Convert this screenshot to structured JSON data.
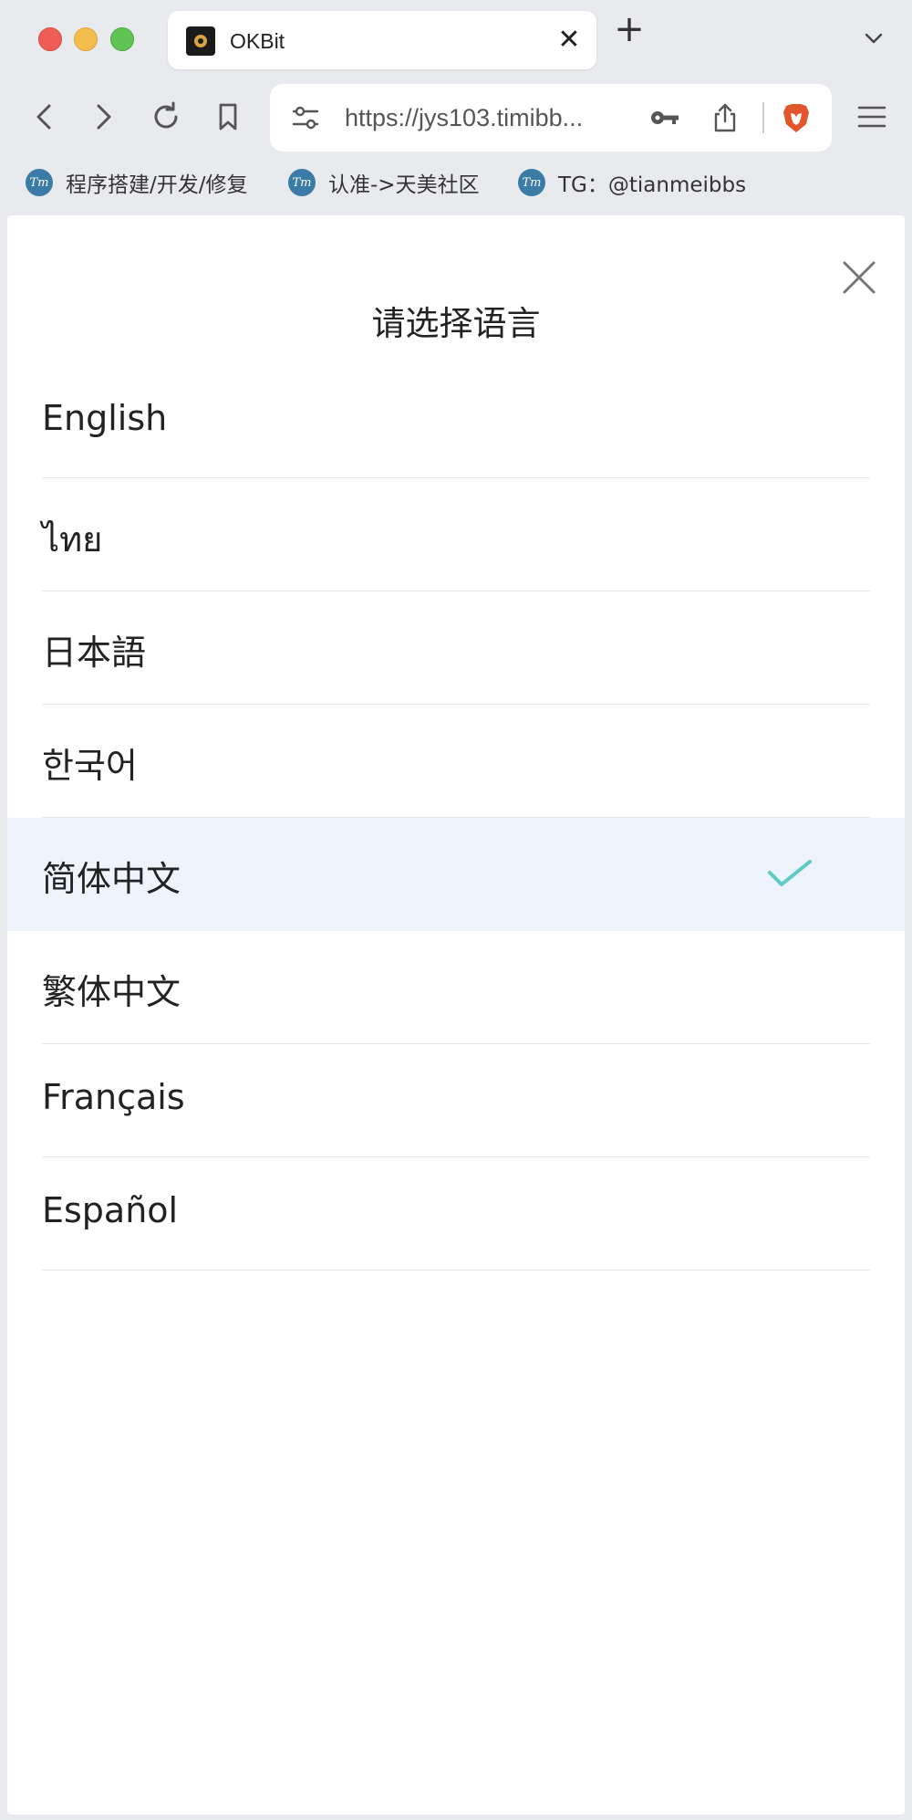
{
  "browser": {
    "tab": {
      "title": "OKBit",
      "close_glyph": "✕"
    },
    "new_tab_glyph": "+",
    "url": "https://jys103.timibb...",
    "bookmarks": [
      {
        "label": "程序搭建/开发/修复",
        "icon": "Tm"
      },
      {
        "label": "认准->天美社区",
        "icon": "Tm"
      },
      {
        "label": "TG：@tianmeibbs",
        "icon": "Tm"
      }
    ],
    "brand_color": "#e2562b"
  },
  "modal": {
    "title": "请选择语言",
    "languages": [
      {
        "label": "English",
        "selected": false
      },
      {
        "label": "ไทย",
        "selected": false
      },
      {
        "label": "日本語",
        "selected": false
      },
      {
        "label": "한국어",
        "selected": false
      },
      {
        "label": "简体中文",
        "selected": true
      },
      {
        "label": "繁体中文",
        "selected": false
      },
      {
        "label": "Français",
        "selected": false
      },
      {
        "label": "Español",
        "selected": false
      }
    ],
    "check_color": "#5ccbc4",
    "selected_bg": "#eff3fc"
  }
}
